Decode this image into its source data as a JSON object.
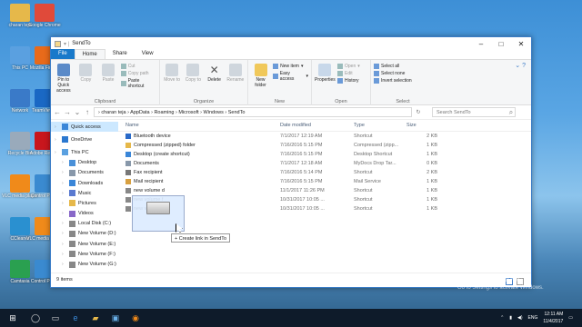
{
  "desktop_icons": [
    {
      "label": "charan teja",
      "color": "#e6b84a"
    },
    {
      "label": "Google Chrome",
      "color": "#e04a3a"
    },
    {
      "label": "This PC",
      "color": "#5aa0e0"
    },
    {
      "label": "Mozilla Firefox",
      "color": "#e86a1a"
    },
    {
      "label": "Network",
      "color": "#3a7ac8"
    },
    {
      "label": "TeamViewer",
      "color": "#1a68c4"
    },
    {
      "label": "Recycle Bin",
      "color": "#9ab"
    },
    {
      "label": "Adobe Reader",
      "color": "#c8161d"
    },
    {
      "label": "VLC media player",
      "color": "#f08a1a"
    },
    {
      "label": "Control Panel",
      "color": "#3a8ad0"
    },
    {
      "label": "CCleaner",
      "color": "#2a90d0"
    },
    {
      "label": "VLC media player",
      "color": "#f08a1a"
    },
    {
      "label": "Camtasia",
      "color": "#2aa050"
    },
    {
      "label": "Control Panel",
      "color": "#3a8ad0"
    }
  ],
  "window": {
    "title": "SendTo",
    "tabs": [
      "File",
      "Home",
      "Share",
      "View"
    ],
    "ribbon": {
      "pin": "Pin to Quick access",
      "copy": "Copy",
      "paste": "Paste",
      "cut": "Cut",
      "copy_path": "Copy path",
      "paste_shortcut": "Paste shortcut",
      "clipboard": "Clipboard",
      "move_to": "Move to",
      "copy_to": "Copy to",
      "delete": "Delete",
      "rename": "Rename",
      "organize": "Organize",
      "new_folder": "New folder",
      "new_item": "New item",
      "easy_access": "Easy access",
      "new": "New",
      "properties": "Properties",
      "open_btn": "Open",
      "edit": "Edit",
      "history": "History",
      "open": "Open",
      "select_all": "Select all",
      "select_none": "Select none",
      "invert_selection": "Invert selection",
      "select": "Select"
    },
    "path": "› charan teja › AppData › Roaming › Microsoft › Windows › SendTo",
    "search_placeholder": "Search SendTo",
    "nav": [
      {
        "label": "Quick access",
        "icon": "star-icon",
        "color": "#3a86d8"
      },
      {
        "label": "OneDrive",
        "icon": "cloud-icon",
        "color": "#2a78d0"
      },
      {
        "label": "This PC",
        "icon": "computer-icon",
        "color": "#5aa0e0"
      },
      {
        "label": "Desktop",
        "icon": "folder-icon",
        "color": "#4a90d8"
      },
      {
        "label": "Documents",
        "icon": "folder-icon",
        "color": "#8898aa"
      },
      {
        "label": "Downloads",
        "icon": "folder-icon",
        "color": "#3a86d8"
      },
      {
        "label": "Music",
        "icon": "folder-icon",
        "color": "#5a7ad0"
      },
      {
        "label": "Pictures",
        "icon": "folder-icon",
        "color": "#e6b84a"
      },
      {
        "label": "Videos",
        "icon": "folder-icon",
        "color": "#8868c8"
      },
      {
        "label": "Local Disk (C:)",
        "icon": "drive-icon",
        "color": "#888"
      },
      {
        "label": "New Volume (D:)",
        "icon": "drive-icon",
        "color": "#888"
      },
      {
        "label": "New Volume (E:)",
        "icon": "drive-icon",
        "color": "#888"
      },
      {
        "label": "New Volume (F:)",
        "icon": "drive-icon",
        "color": "#888"
      },
      {
        "label": "New Volume (G:)",
        "icon": "drive-icon",
        "color": "#888"
      }
    ],
    "columns": {
      "name": "Name",
      "date": "Date modified",
      "type": "Type",
      "size": "Size"
    },
    "files": [
      {
        "name": "Bluetooth device",
        "date": "7/1/2017 12:19 AM",
        "type": "Shortcut",
        "size": "2 KB",
        "color": "#2a6ac8"
      },
      {
        "name": "Compressed (zipped) folder",
        "date": "7/16/2016 5:15 PM",
        "type": "Compressed (zipp...",
        "size": "1 KB",
        "color": "#e6b84a"
      },
      {
        "name": "Desktop (create shortcut)",
        "date": "7/16/2016 5:15 PM",
        "type": "Desktop Shortcut",
        "size": "1 KB",
        "color": "#3a86d8"
      },
      {
        "name": "Documents",
        "date": "7/1/2017 12:18 AM",
        "type": "MyDocs Drop Tar...",
        "size": "0 KB",
        "color": "#8898aa"
      },
      {
        "name": "Fax recipient",
        "date": "7/16/2016 5:14 PM",
        "type": "Shortcut",
        "size": "2 KB",
        "color": "#777"
      },
      {
        "name": "Mail recipient",
        "date": "7/16/2016 5:15 PM",
        "type": "Mail Service",
        "size": "1 KB",
        "color": "#d8a040"
      },
      {
        "name": "new volume d",
        "date": "11/1/2017 11:26 PM",
        "type": "Shortcut",
        "size": "1 KB",
        "color": "#888"
      },
      {
        "name": "new volume f",
        "date": "10/31/2017 10:05 ...",
        "type": "Shortcut",
        "size": "1 KB",
        "color": "#888"
      },
      {
        "name": "new volume G",
        "date": "10/31/2017 10:05 ...",
        "type": "Shortcut",
        "size": "1 KB",
        "color": "#888"
      }
    ],
    "status": "9 items",
    "drag_tooltip": "+ Create link in SendTo"
  },
  "watermark": {
    "line1": "Activate Windows",
    "line2": "Go to Settings to activate Windows."
  },
  "taskbar": {
    "time": "12:11 AM",
    "date": "11/4/2017",
    "lang": "ENG"
  }
}
